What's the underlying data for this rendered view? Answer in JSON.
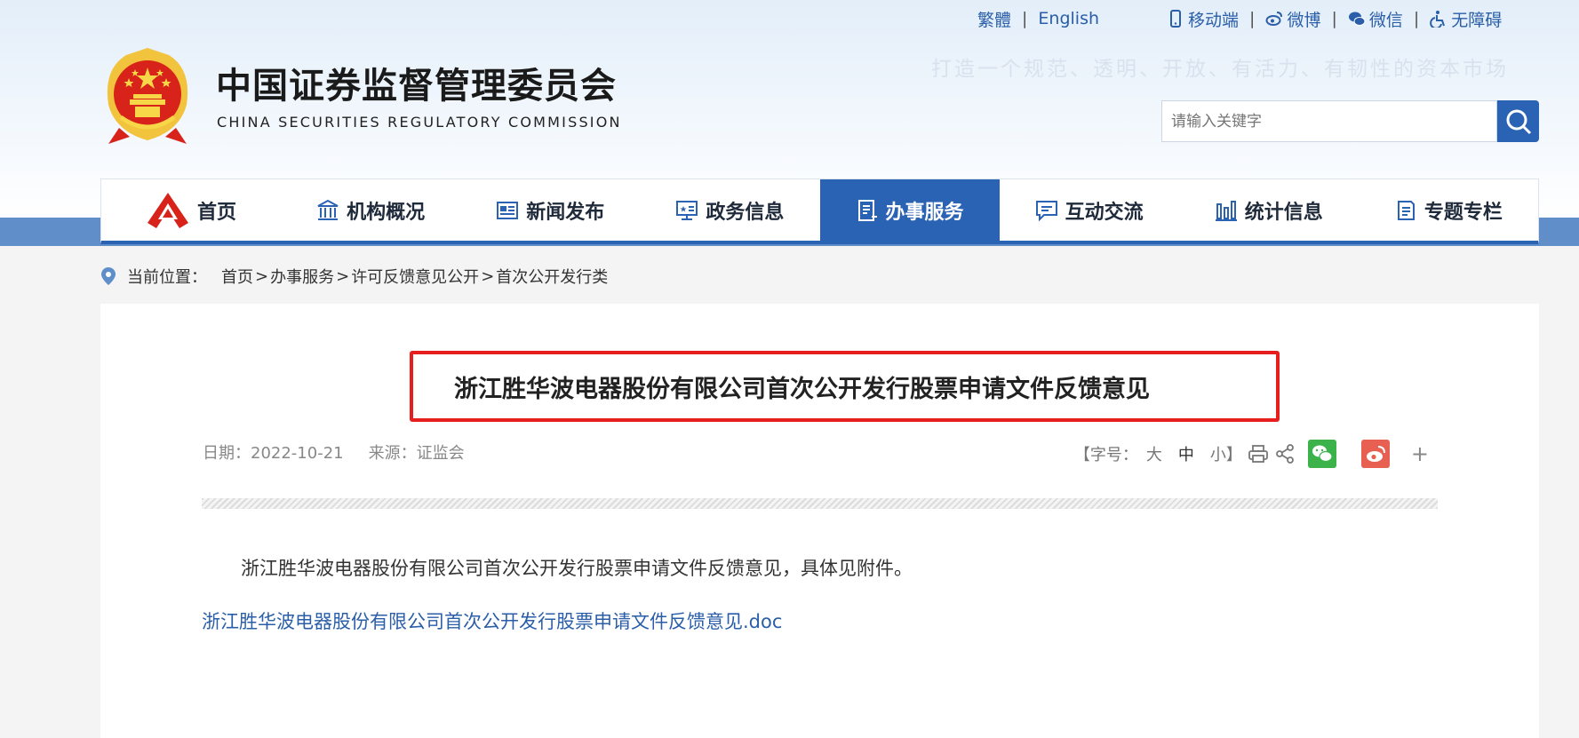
{
  "top_links": {
    "traditional": "繁體",
    "english": "English",
    "mobile": "移动端",
    "weibo": "微博",
    "wechat": "微信",
    "accessibility": "无障碍"
  },
  "slogan": "打造一个规范、透明、开放、有活力、有韧性的资本市场",
  "site": {
    "title_cn": "中国证券监督管理委员会",
    "title_en": "CHINA SECURITIES REGULATORY COMMISSION"
  },
  "search": {
    "placeholder": "请输入关键字"
  },
  "nav": {
    "items": [
      {
        "label": "首页",
        "icon": "csrc-logo-icon"
      },
      {
        "label": "机构概况",
        "icon": "building-icon"
      },
      {
        "label": "新闻发布",
        "icon": "newspaper-icon"
      },
      {
        "label": "政务信息",
        "icon": "monitor-icon"
      },
      {
        "label": "办事服务",
        "icon": "document-icon"
      },
      {
        "label": "互动交流",
        "icon": "chat-icon"
      },
      {
        "label": "统计信息",
        "icon": "bar-chart-icon"
      },
      {
        "label": "专题专栏",
        "icon": "file-icon"
      }
    ],
    "active_index": 4
  },
  "breadcrumb": {
    "label": "当前位置：",
    "items": [
      "首页",
      "办事服务",
      "许可反馈意见公开",
      "首次公开发行类"
    ],
    "separator": ">"
  },
  "article": {
    "title": "浙江胜华波电器股份有限公司首次公开发行股票申请文件反馈意见",
    "date": "日期：2022-10-21",
    "source": "来源：证监会",
    "font_size_label": "【字号：",
    "font_large": "大",
    "font_medium": "中",
    "font_small": "小】",
    "plus": "+",
    "body": "浙江胜华波电器股份有限公司首次公开发行股票申请文件反馈意见，具体见附件。",
    "attachment": "浙江胜华波电器股份有限公司首次公开发行股票申请文件反馈意见.doc"
  },
  "colors": {
    "primary": "#2a62b4",
    "highlight_border": "#e61e1e",
    "link": "#2a5ea8",
    "wechat": "#3bb34a",
    "weibo": "#e76052"
  }
}
